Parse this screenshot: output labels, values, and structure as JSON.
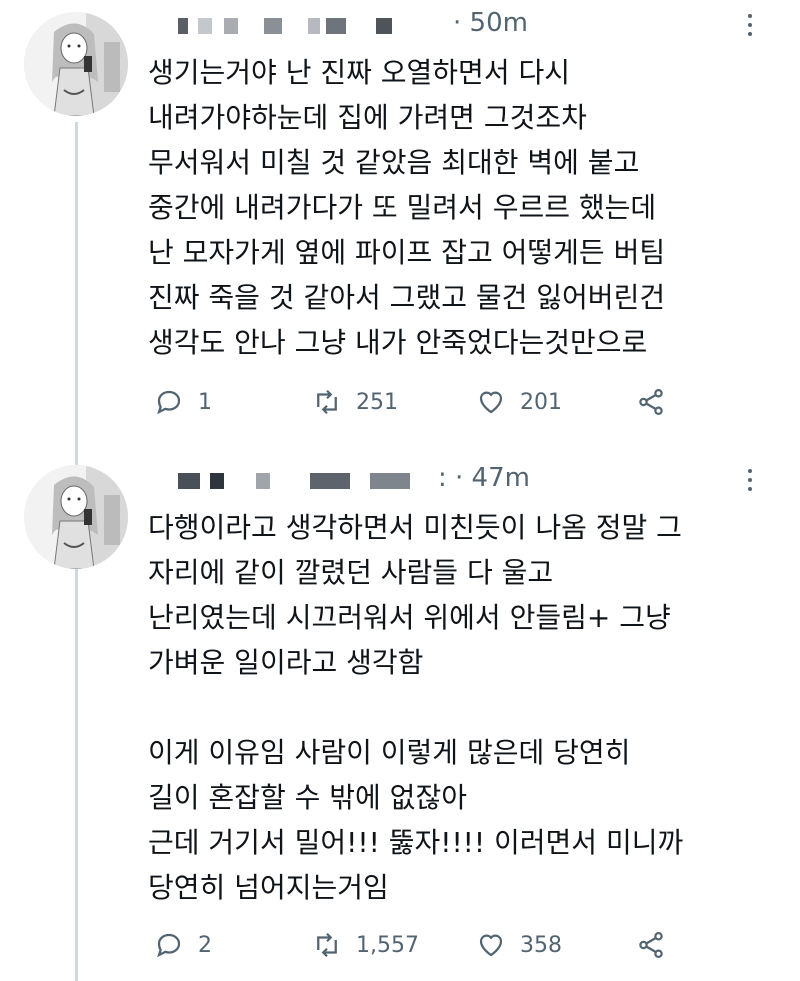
{
  "tweets": [
    {
      "time": "· 50m",
      "text": "생기는거야 난 진짜 오열하면서 다시\n내려가야하눈데 집에 가려면 그것조차\n무서워서 미칠 것 같았음 최대한 벽에 붙고\n중간에 내려가다가 또 밀려서 우르르 했는데\n난 모자가게 옆에 파이프 잡고 어떻게든 버팀\n진짜 죽을 것 같아서 그랬고 물건 잃어버린건\n생각도 안나 그냥 내가 안죽었다는것만으로",
      "replies": "1",
      "retweets": "251",
      "likes": "201"
    },
    {
      "time": ": · 47m",
      "text": "다행이라고 생각하면서 미친듯이 나옴 정말 그\n자리에 같이 깔렸던 사람들 다 울고\n난리였는데 시끄러워서 위에서 안들림+ 그냥\n가벼운 일이라고 생각함\n\n이게 이유임 사람이 이렇게 많은데 당연히\n길이 혼잡할 수 밖에 없잖아\n근데 거기서 밀어!!! 뚫자!!!! 이러면서 미니까\n당연히 넘어지는거임",
      "replies": "2",
      "retweets": "1,557",
      "likes": "358"
    }
  ],
  "icons": {
    "reply": "reply-icon",
    "retweet": "retweet-icon",
    "like": "heart-icon",
    "share": "share-icon",
    "more": "more-icon"
  },
  "colors": {
    "text": "#0f1419",
    "secondary": "#536471",
    "thread_line": "#cfd9de"
  }
}
